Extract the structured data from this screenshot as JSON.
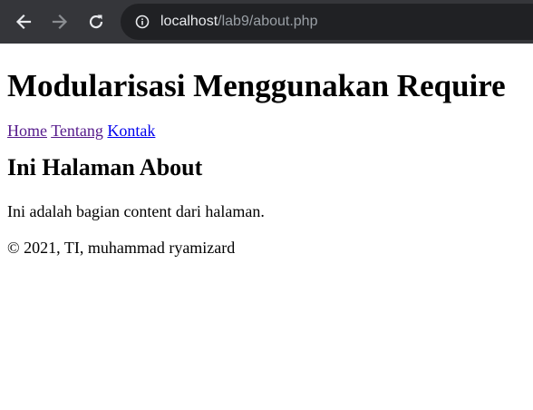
{
  "browser": {
    "url_host": "localhost",
    "url_path": "/lab9/about.php",
    "toolbar_color": "#35363a",
    "omnibox_color": "#202124",
    "icons": [
      "back-arrow-icon",
      "forward-arrow-icon",
      "reload-icon",
      "info-icon"
    ]
  },
  "page": {
    "title": "Modularisasi Menggunakan Require",
    "nav": {
      "home": "Home",
      "tentang": "Tentang",
      "kontak": "Kontak"
    },
    "heading": "Ini Halaman About",
    "content": "Ini adalah bagian content dari halaman.",
    "footer": "© 2021, TI, muhammad ryamizard",
    "link_visited_color": "#551a8b",
    "link_color": "#0000ee"
  }
}
